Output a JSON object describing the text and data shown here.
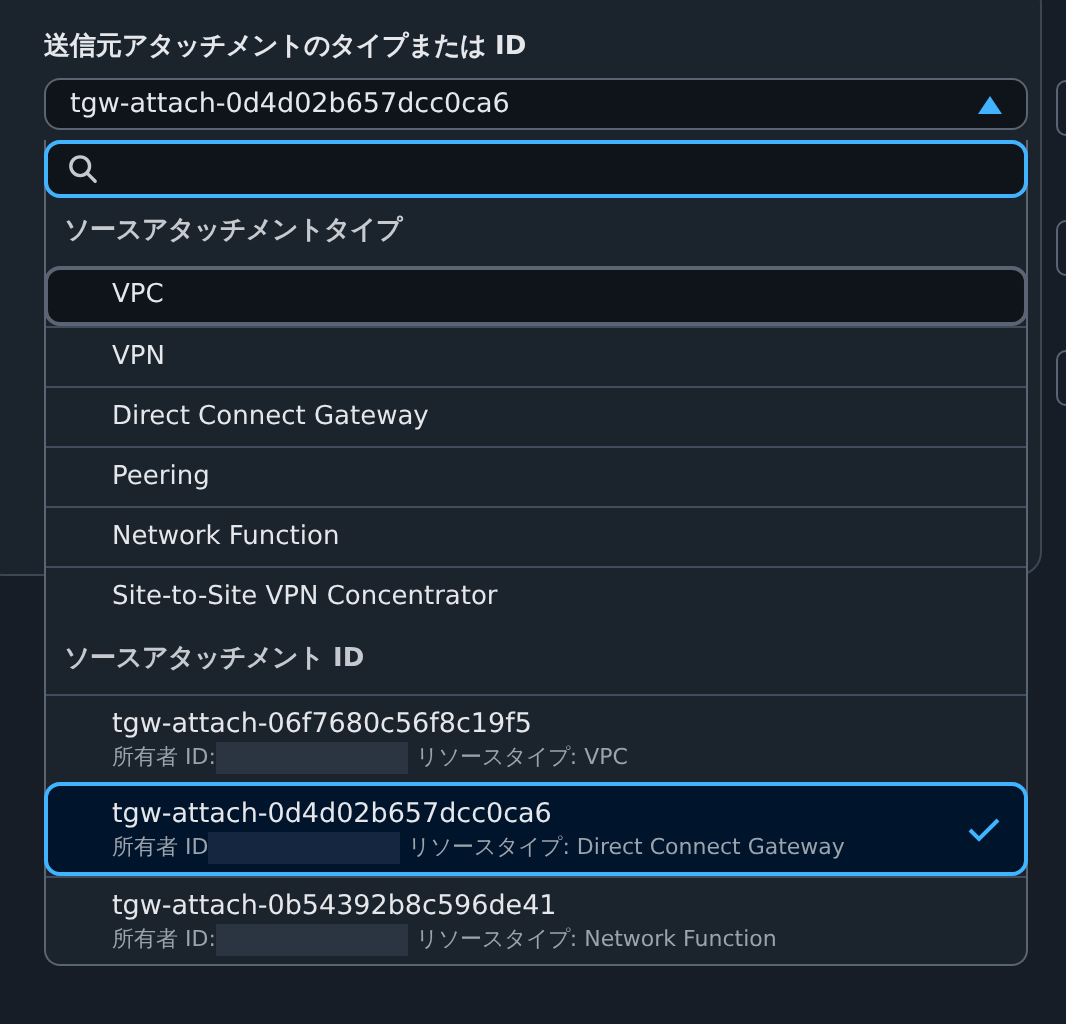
{
  "field": {
    "label": "送信元アタッチメントのタイプまたは ID",
    "value": "tgw-attach-0d4d02b657dcc0ca6",
    "expanded": true
  },
  "groups": [
    {
      "heading": "ソースアタッチメントタイプ",
      "options": [
        {
          "kind": "type",
          "label": "VPC",
          "focused": true
        },
        {
          "kind": "type",
          "label": "VPN",
          "focused": false
        },
        {
          "kind": "type",
          "label": "Direct Connect Gateway",
          "focused": false
        },
        {
          "kind": "type",
          "label": "Peering",
          "focused": false
        },
        {
          "kind": "type",
          "label": "Network Function",
          "focused": false
        },
        {
          "kind": "type",
          "label": "Site-to-Site VPN Concentrator",
          "focused": false
        }
      ]
    },
    {
      "heading": "ソースアタッチメント ID",
      "options": [
        {
          "kind": "attachment",
          "label": "tgw-attach-06f7680c56f8c19f5",
          "owner": "所有者 ID:",
          "resource_type": "リソースタイプ: VPC",
          "selected": false
        },
        {
          "kind": "attachment",
          "label": "tgw-attach-0d4d02b657dcc0ca6",
          "owner": "所有者 ID",
          "resource_type": "リソースタイプ: Direct Connect Gateway",
          "selected": true
        },
        {
          "kind": "attachment",
          "label": "tgw-attach-0b54392b8c596de41",
          "owner": "所有者 ID:",
          "resource_type": "リソースタイプ: Network Function",
          "selected": false
        }
      ]
    }
  ]
}
